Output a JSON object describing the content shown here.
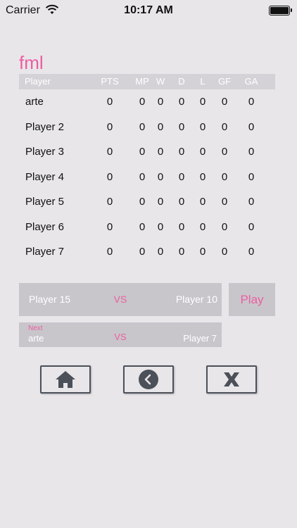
{
  "status_bar": {
    "carrier": "Carrier",
    "time": "10:17 AM"
  },
  "league": {
    "title": "fml"
  },
  "table": {
    "headers": [
      "Player",
      "PTS",
      "MP",
      "W",
      "D",
      "L",
      "GF",
      "GA"
    ],
    "rows": [
      [
        "arte",
        "0",
        "0",
        "0",
        "0",
        "0",
        "0",
        "0"
      ],
      [
        "Player 2",
        "0",
        "0",
        "0",
        "0",
        "0",
        "0",
        "0"
      ],
      [
        "Player 3",
        "0",
        "0",
        "0",
        "0",
        "0",
        "0",
        "0"
      ],
      [
        "Player 4",
        "0",
        "0",
        "0",
        "0",
        "0",
        "0",
        "0"
      ],
      [
        "Player 5",
        "0",
        "0",
        "0",
        "0",
        "0",
        "0",
        "0"
      ],
      [
        "Player 6",
        "0",
        "0",
        "0",
        "0",
        "0",
        "0",
        "0"
      ],
      [
        "Player 7",
        "0",
        "0",
        "0",
        "0",
        "0",
        "0",
        "0"
      ]
    ]
  },
  "current_match": {
    "home": "Player 15",
    "vs": "VS",
    "away": "Player 10"
  },
  "play_button": {
    "label": "Play"
  },
  "next_match": {
    "label": "Next",
    "home": "arte",
    "vs": "VS",
    "away": "Player 7"
  },
  "buttons": {
    "home_icon": "home-icon",
    "back_icon": "back-icon",
    "close_icon": "close-icon"
  },
  "colors": {
    "accent": "#ec5ea0",
    "background": "#e8e6e9",
    "panel": "#c8c6cb",
    "header": "#d4d2d6",
    "icon": "#4b5059"
  }
}
